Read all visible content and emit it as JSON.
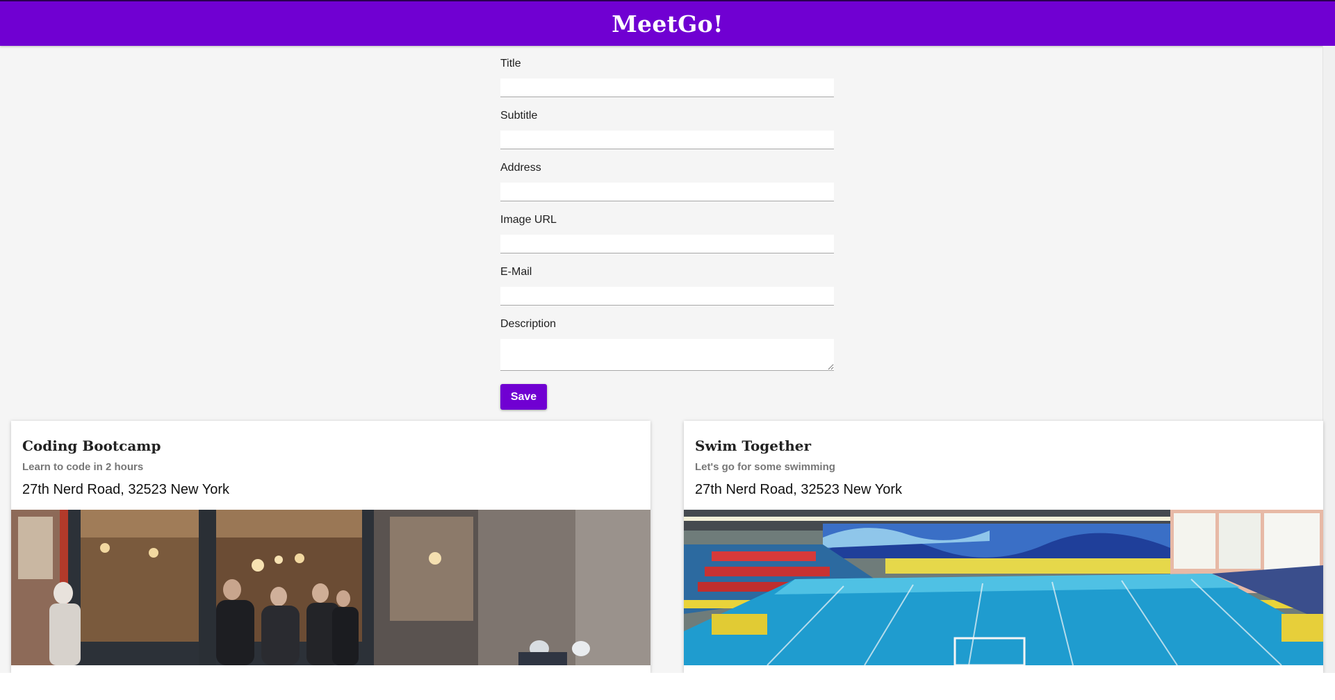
{
  "app": {
    "title": "MeetGo!"
  },
  "form": {
    "fields": [
      {
        "label": "Title",
        "value": ""
      },
      {
        "label": "Subtitle",
        "value": ""
      },
      {
        "label": "Address",
        "value": ""
      },
      {
        "label": "Image URL",
        "value": ""
      },
      {
        "label": "E-Mail",
        "value": ""
      }
    ],
    "description": {
      "label": "Description",
      "value": ""
    },
    "save_label": "Save"
  },
  "meetups": [
    {
      "title": "Coding Bootcamp",
      "subtitle": "Learn to code in 2 hours",
      "address": "27th Nerd Road, 32523 New York",
      "image": "cafe-storefront-photo"
    },
    {
      "title": "Swim Together",
      "subtitle": "Let's go for some swimming",
      "address": "27th Nerd Road, 32523 New York",
      "image": "indoor-swimming-pool-photo"
    }
  ],
  "colors": {
    "primary": "#7000d2",
    "background": "#f5f5f5"
  }
}
